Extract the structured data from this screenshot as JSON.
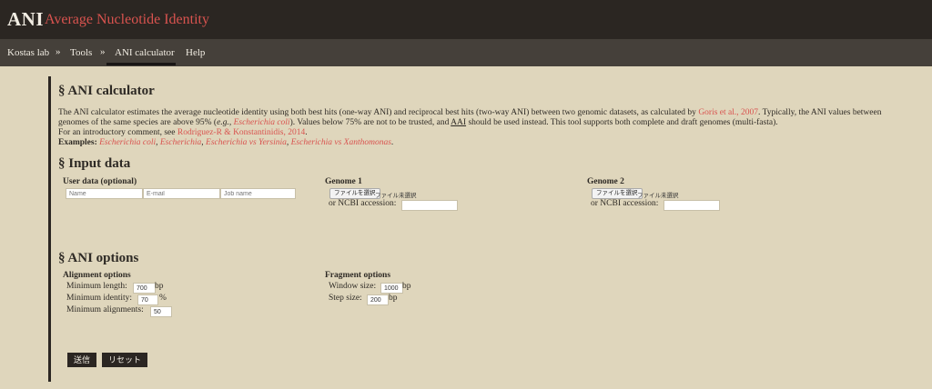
{
  "header": {
    "brand": "ANI",
    "subtitle": "Average Nucleotide Identity"
  },
  "nav": {
    "items": [
      "Kostas lab",
      "Tools",
      "ANI calculator",
      "Help"
    ],
    "separator": "»"
  },
  "section_calculator": {
    "title": "§ ANI calculator",
    "line1_pre": "The ANI calculator estimates the average nucleotide identity using both best hits (one-way ANI) and reciprocal best hits (two-way ANI) between two genomic datasets, as calculated by ",
    "line1_link": "Goris et al., 2007",
    "line1_post": ". Typically, the ANI values between",
    "line2_pre": "genomes of the same species are above 95% (",
    "line2_eg": "e.g.",
    "line2_comma": ", ",
    "line2_link": "Escherichia coli",
    "line2_mid": "). Values below 75% are not to be trusted, and ",
    "line2_aai": "AAI",
    "line2_post": " should be used instead. This tool supports both complete and draft genomes (multi-fasta).",
    "line3_pre": "For an introductory comment, see ",
    "line3_link": "Rodriguez-R & Konstantinidis, 2014",
    "line3_post": ".",
    "examples_label": "Examples:",
    "examples": [
      "Escherichia coli",
      "Escherichia",
      "Escherichia vs Yersinia",
      "Escherichia vs Xanthomonas"
    ],
    "ex_sep": ", ",
    "ex_end": "."
  },
  "section_input": {
    "title": "§ Input data",
    "user_data_label": "User data (optional)",
    "name_placeholder": "Name",
    "email_placeholder": "E-mail",
    "job_placeholder": "Job name",
    "genome1_label": "Genome 1",
    "genome2_label": "Genome 2",
    "file_button": "ファイルを選択",
    "file_status": "ファイル未選択",
    "ncbi_label": "or NCBI accession:"
  },
  "section_options": {
    "title": "§ ANI options",
    "alignment_label": "Alignment options",
    "min_length_label": "Minimum length:",
    "min_length_value": "700",
    "min_length_unit": "bp",
    "min_identity_label": "Minimum identity:",
    "min_identity_value": "70",
    "min_identity_unit": "%",
    "min_alignments_label": "Minimum alignments:",
    "min_alignments_value": "50",
    "fragment_label": "Fragment options",
    "window_label": "Window size:",
    "window_value": "1000",
    "window_unit": "bp",
    "step_label": "Step size:",
    "step_value": "200",
    "step_unit": "bp"
  },
  "buttons": {
    "submit": "送信",
    "reset": "リセット"
  },
  "colors": {
    "accent": "#d9534f",
    "header": "#2b2622",
    "nav": "#45403a",
    "background": "#dfd6bc"
  }
}
